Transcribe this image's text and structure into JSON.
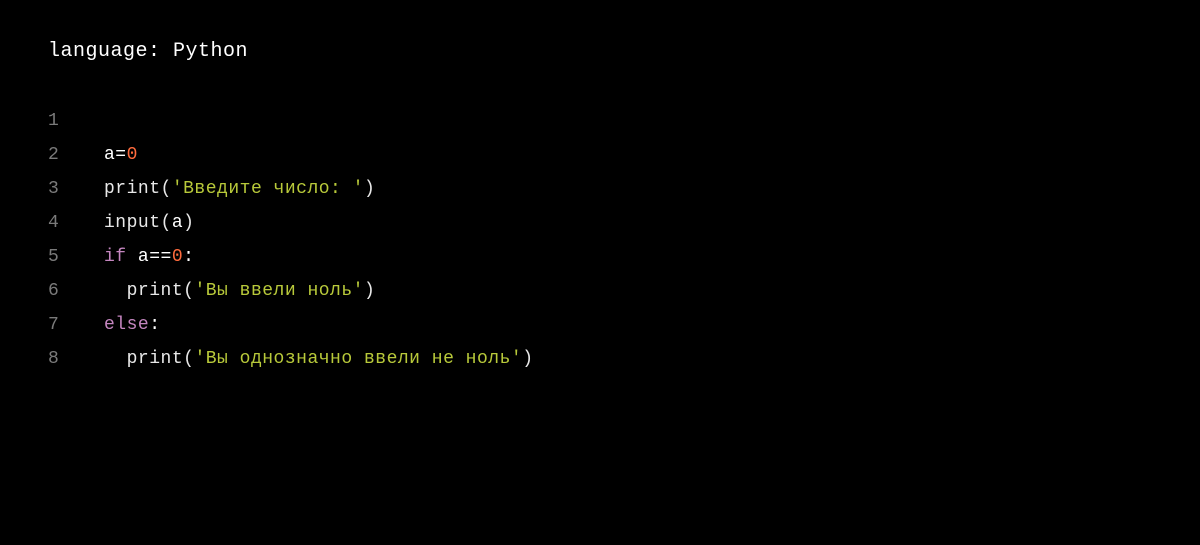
{
  "header": {
    "language_label": "language:",
    "language": "Python"
  },
  "code": {
    "lines": [
      {
        "num": "1",
        "tokens": []
      },
      {
        "num": "2",
        "tokens": [
          {
            "cls": "c-default",
            "t": "a="
          },
          {
            "cls": "c-number",
            "t": "0"
          }
        ]
      },
      {
        "num": "3",
        "tokens": [
          {
            "cls": "c-func",
            "t": "print"
          },
          {
            "cls": "c-paren",
            "t": "("
          },
          {
            "cls": "c-string",
            "t": "'Введите число: '"
          },
          {
            "cls": "c-paren",
            "t": ")"
          }
        ]
      },
      {
        "num": "4",
        "tokens": [
          {
            "cls": "c-func",
            "t": "input"
          },
          {
            "cls": "c-paren",
            "t": "("
          },
          {
            "cls": "c-default",
            "t": "a"
          },
          {
            "cls": "c-paren",
            "t": ")"
          }
        ]
      },
      {
        "num": "5",
        "tokens": [
          {
            "cls": "c-keyword",
            "t": "if"
          },
          {
            "cls": "c-default",
            "t": " a=="
          },
          {
            "cls": "c-number",
            "t": "0"
          },
          {
            "cls": "c-default",
            "t": ":"
          }
        ]
      },
      {
        "num": "6",
        "tokens": [
          {
            "cls": "c-default",
            "t": "  "
          },
          {
            "cls": "c-func",
            "t": "print"
          },
          {
            "cls": "c-paren",
            "t": "("
          },
          {
            "cls": "c-string",
            "t": "'Вы ввели ноль'"
          },
          {
            "cls": "c-paren",
            "t": ")"
          }
        ]
      },
      {
        "num": "7",
        "tokens": [
          {
            "cls": "c-keyword",
            "t": "else"
          },
          {
            "cls": "c-default",
            "t": ":"
          }
        ]
      },
      {
        "num": "8",
        "tokens": [
          {
            "cls": "c-default",
            "t": "  "
          },
          {
            "cls": "c-func",
            "t": "print"
          },
          {
            "cls": "c-paren",
            "t": "("
          },
          {
            "cls": "c-string",
            "t": "'Вы однозначно ввели не ноль'"
          },
          {
            "cls": "c-paren",
            "t": ")"
          }
        ]
      }
    ]
  }
}
